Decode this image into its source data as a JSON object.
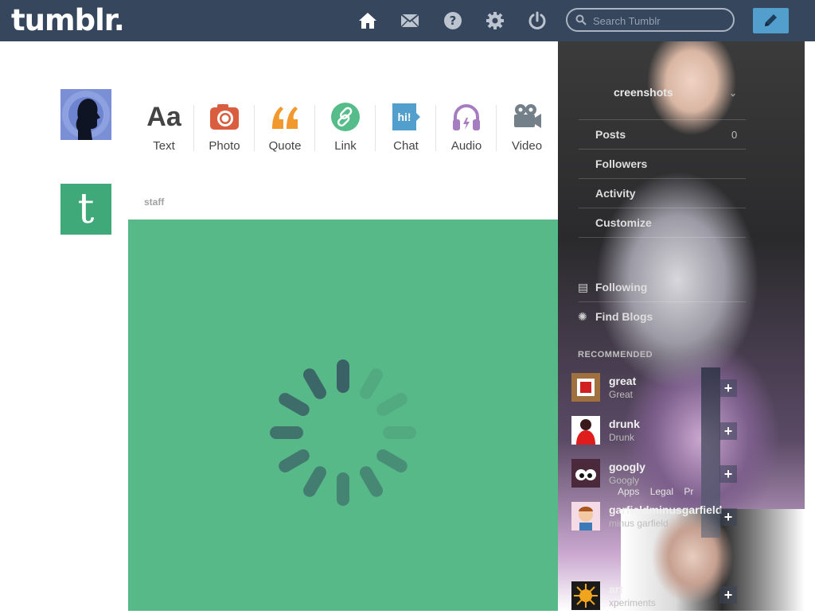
{
  "header": {
    "logo": "tumblr.",
    "search_placeholder": "Search Tumblr",
    "nav": [
      "home-icon",
      "mail-icon",
      "help-icon",
      "settings-icon",
      "power-icon"
    ]
  },
  "post_types": [
    {
      "label": "Text",
      "color": "#444444"
    },
    {
      "label": "Photo",
      "color": "#d95e40"
    },
    {
      "label": "Quote",
      "color": "#f2992e"
    },
    {
      "label": "Link",
      "color": "#56bc8a"
    },
    {
      "label": "Chat",
      "color": "#529ecc"
    },
    {
      "label": "Audio",
      "color": "#a77dc2"
    },
    {
      "label": "Video",
      "color": "#748089"
    }
  ],
  "post": {
    "author": "staff",
    "media_color": "#57b987"
  },
  "sidebar": {
    "blog_name": "creenshots",
    "posts_label": "Posts",
    "posts_count": "0",
    "followers_label": "Followers",
    "activity_label": "Activity",
    "customize_label": "Customize",
    "following_label": "Following",
    "find_blogs_label": "Find Blogs",
    "recommended_label": "RECOMMENDED",
    "recommended": [
      {
        "name": "great",
        "desc": "Great"
      },
      {
        "name": "drunk",
        "desc": "Drunk"
      },
      {
        "name": "googly",
        "desc": "Googly"
      },
      {
        "name": "garfieldminusgarfield",
        "desc": "minus garfield"
      },
      {
        "name": "art",
        "desc": "xperiments"
      }
    ],
    "footer": [
      "Apps",
      "Legal",
      "Pr"
    ]
  },
  "colors": {
    "header_bg": "#36465d",
    "compose_btn": "#529ecc",
    "staff_avatar": "#3fa97a"
  }
}
